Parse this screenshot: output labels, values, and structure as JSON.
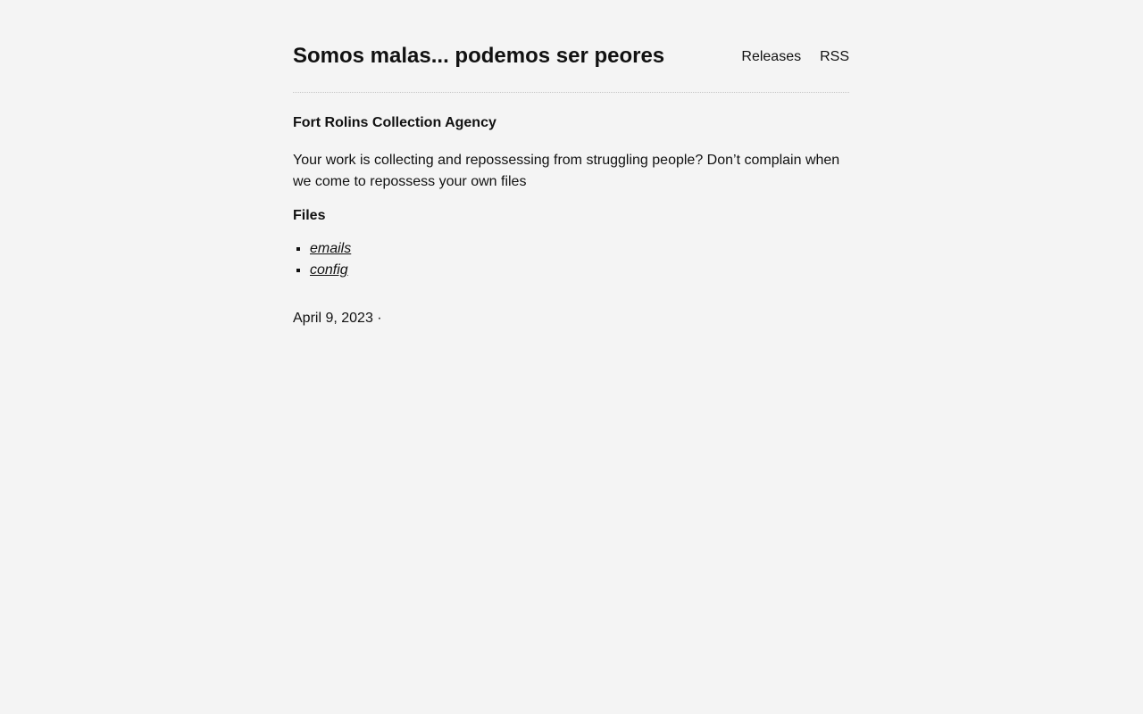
{
  "header": {
    "site_title": "Somos malas... podemos ser peores",
    "nav": {
      "releases": "Releases",
      "rss": "RSS"
    }
  },
  "post": {
    "title": "Fort Rolins Collection Agency",
    "body": "Your work is collecting and repossessing from struggling people? Don’t complain when we come to repossess your own files",
    "files_heading": "Files",
    "files": [
      "emails",
      "config"
    ],
    "date": "April 9, 2023",
    "meta_separator": "·"
  }
}
